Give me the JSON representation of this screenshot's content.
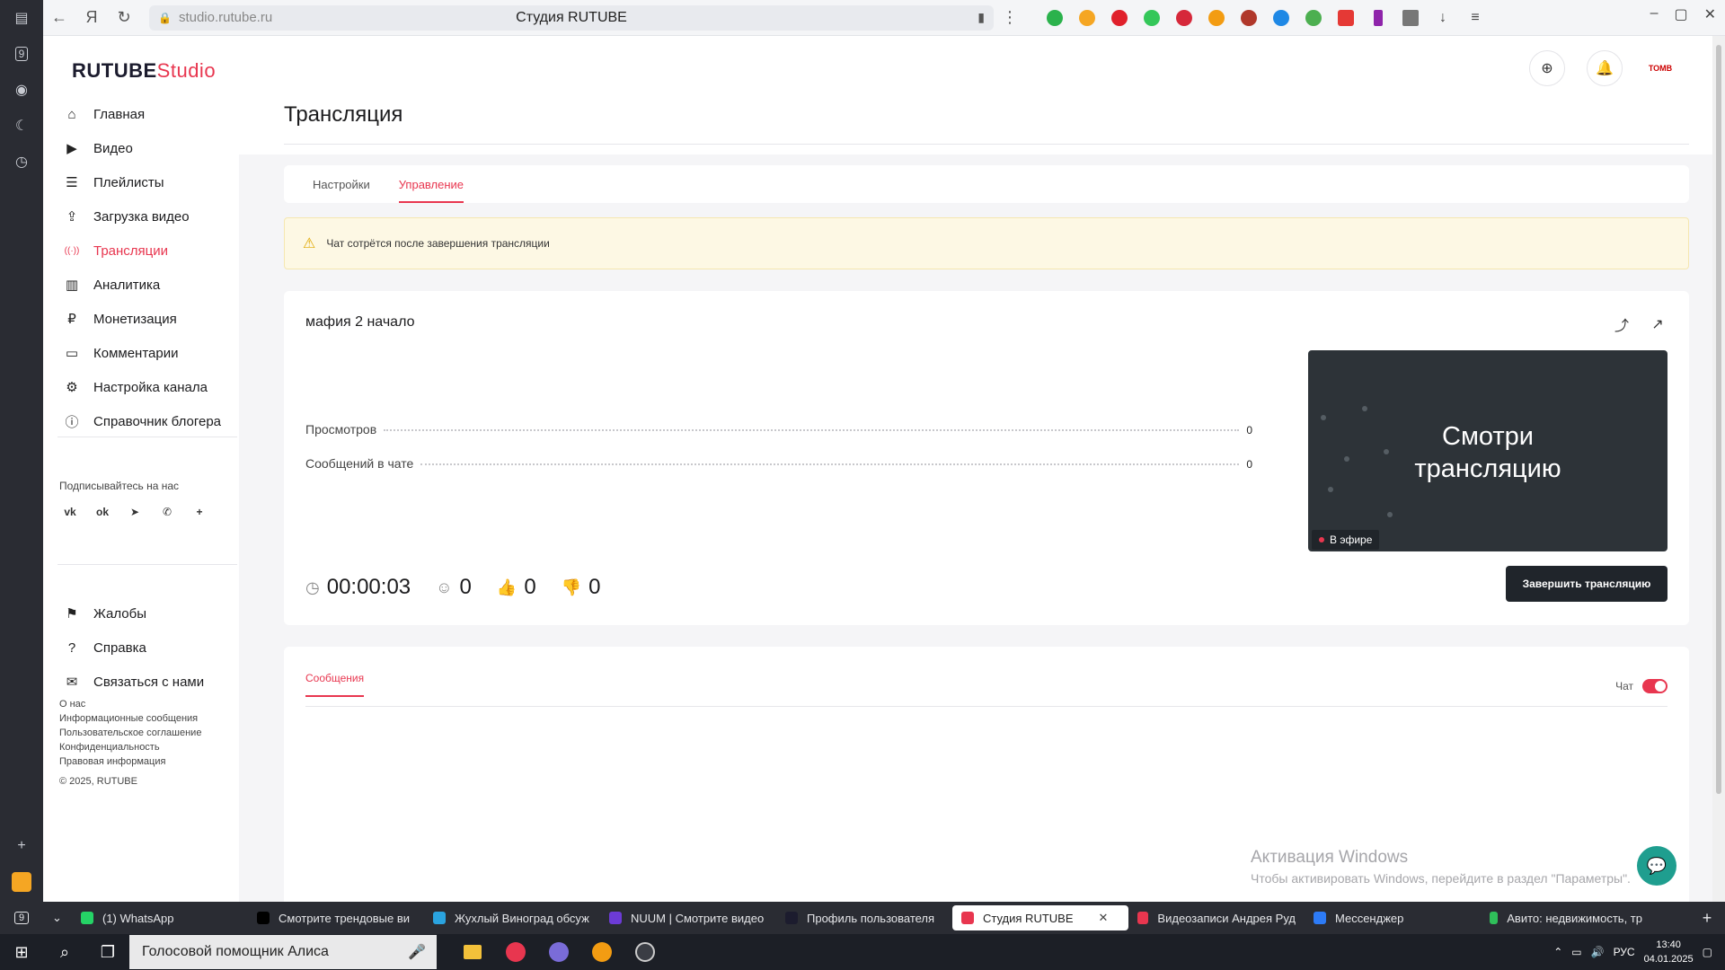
{
  "browser": {
    "url": "studio.rutube.ru",
    "tab_title": "Студия RUTUBE",
    "left_badge": "9"
  },
  "sidebar": {
    "logo_main": "RUTUBE",
    "logo_studio": "Studio",
    "items": [
      {
        "label": "Главная",
        "icon": "home-icon"
      },
      {
        "label": "Видео",
        "icon": "video-icon"
      },
      {
        "label": "Плейлисты",
        "icon": "playlist-icon"
      },
      {
        "label": "Загрузка видео",
        "icon": "upload-icon"
      },
      {
        "label": "Трансляции",
        "icon": "broadcast-icon",
        "active": true
      },
      {
        "label": "Аналитика",
        "icon": "analytics-icon"
      },
      {
        "label": "Монетизация",
        "icon": "monetization-icon"
      },
      {
        "label": "Комментарии",
        "icon": "comment-icon"
      },
      {
        "label": "Настройка канала",
        "icon": "gear-icon"
      },
      {
        "label": "Справочник блогера",
        "icon": "info-icon"
      }
    ],
    "subscribe_label": "Подписывайтесь на нас",
    "socials": [
      "vk",
      "ok",
      "telegram",
      "viber",
      "+"
    ],
    "items2": [
      {
        "label": "Жалобы",
        "icon": "flag-icon"
      },
      {
        "label": "Справка",
        "icon": "help-icon"
      },
      {
        "label": "Связаться с нами",
        "icon": "mail-icon"
      }
    ],
    "footer_links": [
      "О нас",
      "Информационные сообщения",
      "Пользовательское соглашение",
      "Конфиденциальность",
      "Правовая информация"
    ],
    "copyright": "© 2025, RUTUBE"
  },
  "main": {
    "page_title": "Трансляция",
    "tabs": [
      {
        "label": "Настройки",
        "active": false
      },
      {
        "label": "Управление",
        "active": true
      }
    ],
    "warning": "Чат сотрётся после завершения трансляции",
    "stream": {
      "title": "мафия 2 начало",
      "stats": [
        {
          "label": "Просмотров",
          "value": "0"
        },
        {
          "label": "Сообщений в чате",
          "value": "0"
        }
      ],
      "preview_text_1": "Смотри",
      "preview_text_2": "трансляцию",
      "live_badge": "В эфире",
      "timer": "00:00:03",
      "viewers": "0",
      "likes": "0",
      "dislikes": "0",
      "end_button": "Завершить трансляцию"
    },
    "messages": {
      "tab_label": "Сообщения",
      "chat_label": "Чат"
    }
  },
  "watermark": {
    "line1": "Активация Windows",
    "line2": "Чтобы активировать Windows, перейдите в раздел \"Параметры\"."
  },
  "browser_tabs": [
    {
      "label": "(1) WhatsApp",
      "color": "#25d366"
    },
    {
      "label": "Смотрите трендовые ви",
      "color": "#000000"
    },
    {
      "label": "Жухлый Виноград обсуж",
      "color": "#2aa3df"
    },
    {
      "label": "NUUM | Смотрите видео",
      "color": "#6c3bd6"
    },
    {
      "label": "Профиль пользователя",
      "color": "#1c1c2e"
    },
    {
      "label": "Студия RUTUBE",
      "color": "#e8364f",
      "active": true
    },
    {
      "label": "Видеозаписи Андрея Руд",
      "color": "#e8364f"
    },
    {
      "label": "Мессенджер",
      "color": "#2d7bf6"
    },
    {
      "label": "Авито: недвижимость, тр",
      "color": "#2fbf5a"
    }
  ],
  "taskbar": {
    "search_placeholder": "Голосовой помощник Алиса",
    "lang": "РУС",
    "time": "13:40",
    "date": "04.01.2025"
  }
}
